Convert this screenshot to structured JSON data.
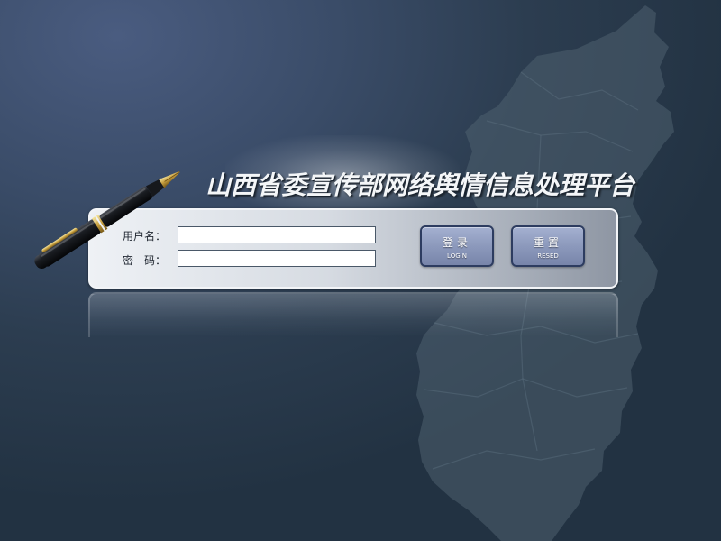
{
  "title": "山西省委宣传部网络舆情信息处理平台",
  "form": {
    "username_label": "用户名：",
    "password_label": "密　码：",
    "username_value": "",
    "password_value": ""
  },
  "buttons": {
    "login": {
      "label": "登录",
      "sub_label": "LOGIN"
    },
    "reset": {
      "label": "重置",
      "sub_label": "RESED"
    }
  },
  "icons": {
    "pen": "fountain-pen-icon",
    "map": "shanxi-province-map"
  },
  "colors": {
    "background": "#2c3d50",
    "map": "#4a5c68",
    "panel": "#d6dbe2",
    "button": "#8c99bc",
    "button_border": "#2d3c60",
    "title": "#f4f6f8"
  }
}
